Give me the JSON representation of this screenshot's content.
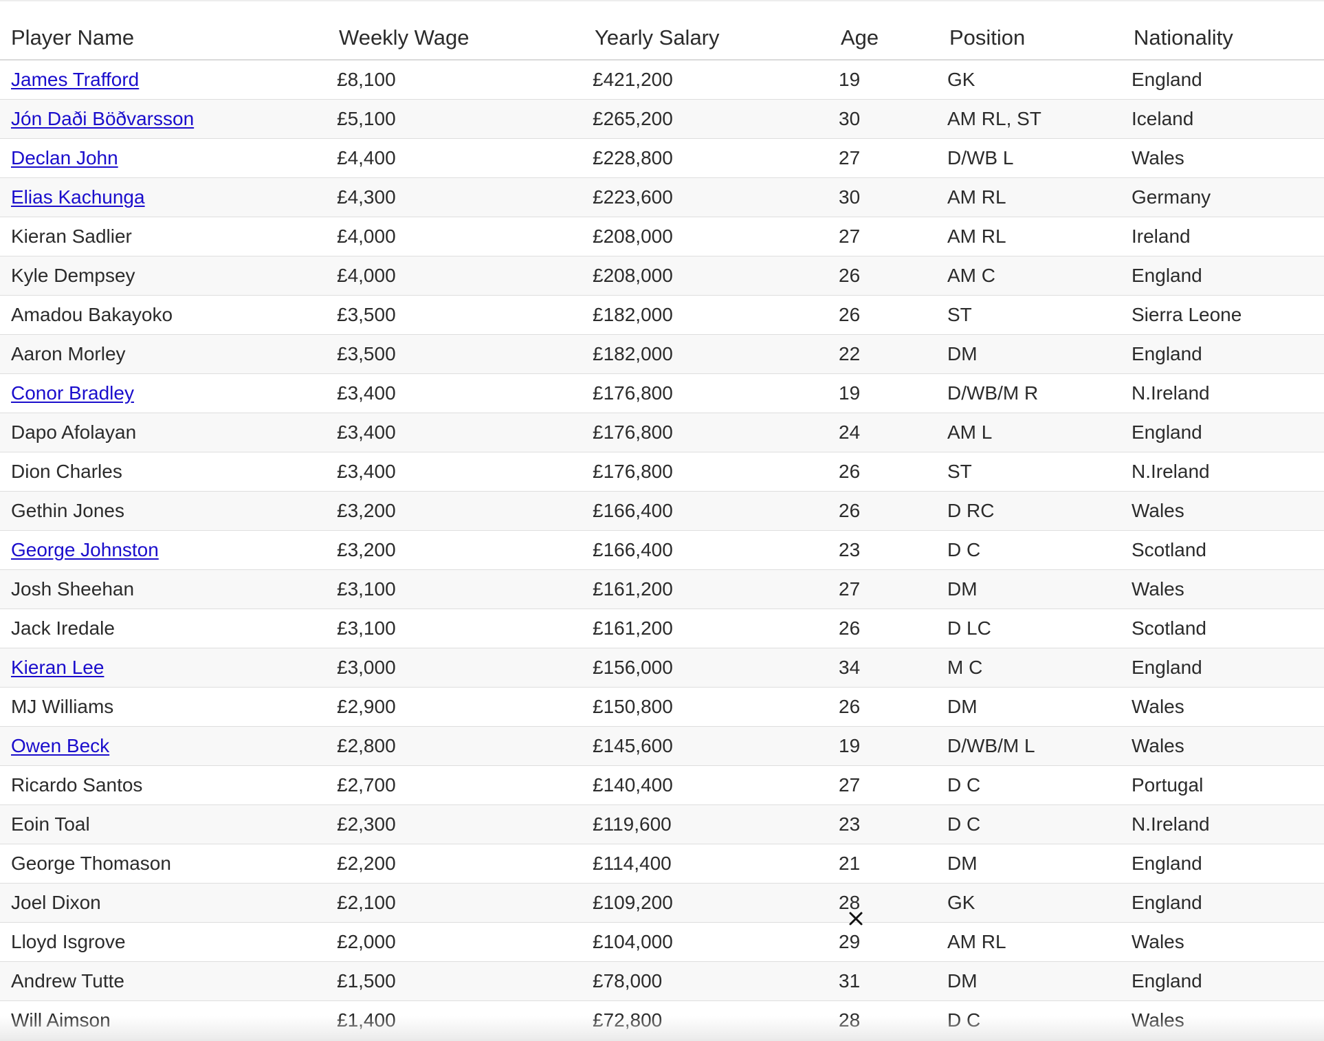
{
  "table": {
    "headers": {
      "player_name": "Player Name",
      "weekly_wage": "Weekly Wage",
      "yearly_salary": "Yearly Salary",
      "age": "Age",
      "position": "Position",
      "nationality": "Nationality"
    },
    "rows": [
      {
        "name": "James Trafford",
        "link": true,
        "weekly": "£8,100",
        "yearly": "£421,200",
        "age": "19",
        "position": "GK",
        "nationality": "England"
      },
      {
        "name": "Jón Daði Böðvarsson",
        "link": true,
        "weekly": "£5,100",
        "yearly": "£265,200",
        "age": "30",
        "position": "AM RL, ST",
        "nationality": "Iceland"
      },
      {
        "name": "Declan John",
        "link": true,
        "weekly": "£4,400",
        "yearly": "£228,800",
        "age": "27",
        "position": "D/WB L",
        "nationality": "Wales"
      },
      {
        "name": "Elias Kachunga",
        "link": true,
        "weekly": "£4,300",
        "yearly": "£223,600",
        "age": "30",
        "position": "AM RL",
        "nationality": "Germany"
      },
      {
        "name": "Kieran Sadlier",
        "link": false,
        "weekly": "£4,000",
        "yearly": "£208,000",
        "age": "27",
        "position": "AM RL",
        "nationality": "Ireland"
      },
      {
        "name": "Kyle Dempsey",
        "link": false,
        "weekly": "£4,000",
        "yearly": "£208,000",
        "age": "26",
        "position": "AM C",
        "nationality": "England"
      },
      {
        "name": "Amadou Bakayoko",
        "link": false,
        "weekly": "£3,500",
        "yearly": "£182,000",
        "age": "26",
        "position": "ST",
        "nationality": "Sierra Leone"
      },
      {
        "name": "Aaron Morley",
        "link": false,
        "weekly": "£3,500",
        "yearly": "£182,000",
        "age": "22",
        "position": "DM",
        "nationality": "England"
      },
      {
        "name": "Conor Bradley",
        "link": true,
        "weekly": "£3,400",
        "yearly": "£176,800",
        "age": "19",
        "position": "D/WB/M R",
        "nationality": "N.Ireland"
      },
      {
        "name": "Dapo Afolayan",
        "link": false,
        "weekly": "£3,400",
        "yearly": "£176,800",
        "age": "24",
        "position": "AM L",
        "nationality": "England"
      },
      {
        "name": "Dion Charles",
        "link": false,
        "weekly": "£3,400",
        "yearly": "£176,800",
        "age": "26",
        "position": "ST",
        "nationality": "N.Ireland"
      },
      {
        "name": "Gethin Jones",
        "link": false,
        "weekly": "£3,200",
        "yearly": "£166,400",
        "age": "26",
        "position": "D RC",
        "nationality": "Wales"
      },
      {
        "name": "George Johnston",
        "link": true,
        "weekly": "£3,200",
        "yearly": "£166,400",
        "age": "23",
        "position": "D C",
        "nationality": "Scotland"
      },
      {
        "name": "Josh Sheehan",
        "link": false,
        "weekly": "£3,100",
        "yearly": "£161,200",
        "age": "27",
        "position": "DM",
        "nationality": "Wales"
      },
      {
        "name": "Jack Iredale",
        "link": false,
        "weekly": "£3,100",
        "yearly": "£161,200",
        "age": "26",
        "position": "D LC",
        "nationality": "Scotland"
      },
      {
        "name": "Kieran Lee",
        "link": true,
        "weekly": "£3,000",
        "yearly": "£156,000",
        "age": "34",
        "position": "M C",
        "nationality": "England"
      },
      {
        "name": "MJ Williams",
        "link": false,
        "weekly": "£2,900",
        "yearly": "£150,800",
        "age": "26",
        "position": "DM",
        "nationality": "Wales"
      },
      {
        "name": "Owen Beck",
        "link": true,
        "weekly": "£2,800",
        "yearly": "£145,600",
        "age": "19",
        "position": "D/WB/M L",
        "nationality": "Wales"
      },
      {
        "name": "Ricardo Santos",
        "link": false,
        "weekly": "£2,700",
        "yearly": "£140,400",
        "age": "27",
        "position": "D C",
        "nationality": "Portugal"
      },
      {
        "name": "Eoin Toal",
        "link": false,
        "weekly": "£2,300",
        "yearly": "£119,600",
        "age": "23",
        "position": "D C",
        "nationality": "N.Ireland"
      },
      {
        "name": "George Thomason",
        "link": false,
        "weekly": "£2,200",
        "yearly": "£114,400",
        "age": "21",
        "position": "DM",
        "nationality": "England"
      },
      {
        "name": "Joel Dixon",
        "link": false,
        "weekly": "£2,100",
        "yearly": "£109,200",
        "age": "28",
        "position": "GK",
        "nationality": "England"
      },
      {
        "name": "Lloyd Isgrove",
        "link": false,
        "weekly": "£2,000",
        "yearly": "£104,000",
        "age": "29",
        "position": "AM RL",
        "nationality": "Wales"
      },
      {
        "name": "Andrew Tutte",
        "link": false,
        "weekly": "£1,500",
        "yearly": "£78,000",
        "age": "31",
        "position": "DM",
        "nationality": "England"
      },
      {
        "name": "Will Aimson",
        "link": false,
        "weekly": "£1,400",
        "yearly": "£72,800",
        "age": "28",
        "position": "D C",
        "nationality": "Wales"
      }
    ]
  },
  "colors": {
    "link": "#1a0dcc",
    "text": "#2b2b2b",
    "row_stripe": "#f8f8f8",
    "border": "#dedede"
  },
  "icons": {
    "cursor": "cross-cursor-icon"
  }
}
